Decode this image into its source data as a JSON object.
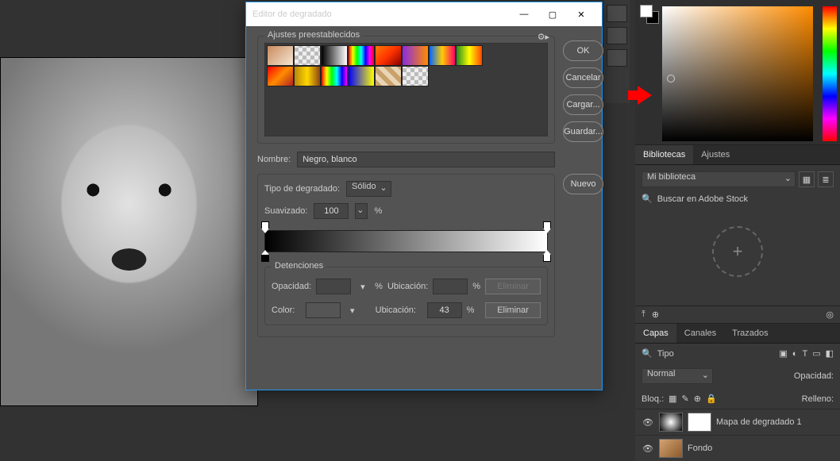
{
  "dialog": {
    "title": "Editor de degradado",
    "presets_label": "Ajustes preestablecidos",
    "buttons": {
      "ok": "OK",
      "cancel": "Cancelar",
      "load": "Cargar...",
      "save": "Guardar...",
      "new": "Nuevo"
    },
    "name_label": "Nombre:",
    "name_value": "Negro, blanco",
    "type_label": "Tipo de degradado:",
    "type_value": "Sólido",
    "smooth_label": "Suavizado:",
    "smooth_value": "100",
    "percent": "%",
    "stops_label": "Detenciones",
    "opacity_label": "Opacidad:",
    "location_label": "Ubicación:",
    "color_label": "Color:",
    "delete": "Eliminar",
    "location_value": "43",
    "preset_styles": [
      "linear-gradient(135deg,#c98b5e,#f5e6d3)",
      "repeating-conic-gradient(#bbb 0 25%,#eee 0 50%) 0/10px 10px",
      "linear-gradient(90deg,#000,#fff)",
      "linear-gradient(90deg,#f00,#ff0,#0f0,#0ff,#00f,#f0f,#f00)",
      "linear-gradient(135deg,#ff7b00,#ff3300,#8b0000)",
      "linear-gradient(90deg,#8a2be2,#ff8c00)",
      "linear-gradient(90deg,#0066ff,#ffcc00,#ff0066)",
      "linear-gradient(90deg,#228b22,#ffff00,#ff4500)",
      "linear-gradient(135deg,#ff0000,#ff8c00,#b22222)",
      "linear-gradient(90deg,#b8860b,#ffd700,#8b4513)",
      "linear-gradient(90deg,#f00,#ff0,#0f0,#0ff,#00f,#f0f)",
      "linear-gradient(90deg,#0000ff,#ffff00)",
      "repeating-linear-gradient(45deg,#c9a16a 0 6px,#e8d5b5 6px 12px)",
      "repeating-conic-gradient(#bbb 0 25%,#eee 0 50%) 0/10px 10px"
    ]
  },
  "panels": {
    "tabs1": {
      "bibliotecas": "Bibliotecas",
      "ajustes": "Ajustes"
    },
    "lib": {
      "selected": "Mi biblioteca",
      "search": "Buscar en Adobe Stock"
    },
    "tabs2": {
      "capas": "Capas",
      "canales": "Canales",
      "trazados": "Trazados"
    },
    "layers": {
      "kind": "Tipo",
      "mode": "Normal",
      "opacity_label": "Opacidad:",
      "lock_label": "Bloq.:",
      "fill_label": "Relleno:",
      "layer1": "Mapa de degradado 1",
      "layer2": "Fondo"
    }
  }
}
